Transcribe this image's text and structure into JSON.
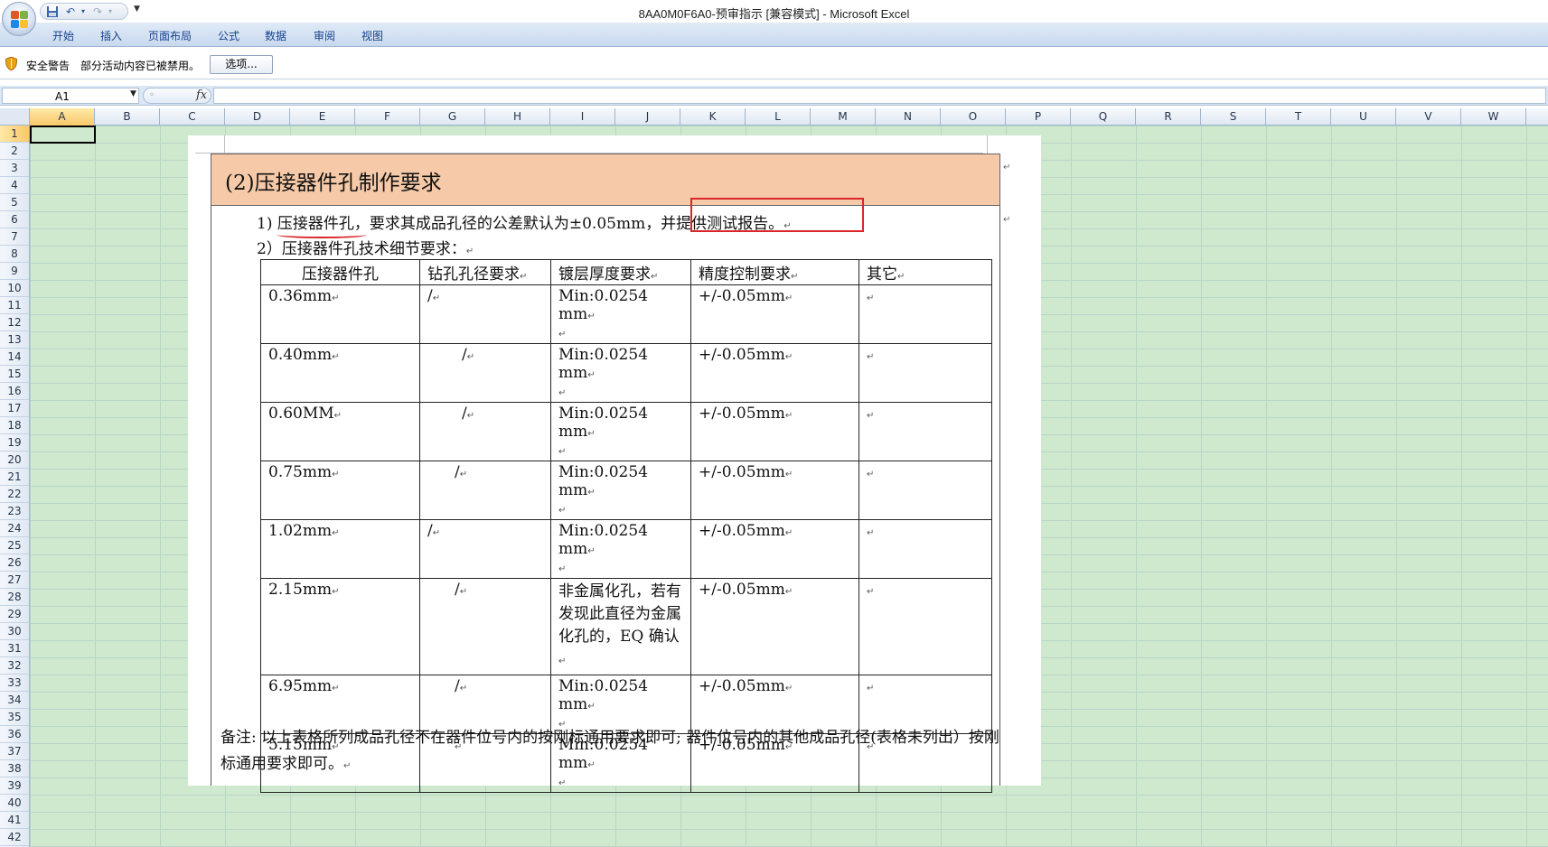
{
  "window": {
    "title": "8AA0M0F6A0-预审指示  [兼容模式] - Microsoft Excel",
    "qat_save": "save-icon",
    "qat_undo": "undo-icon",
    "qat_redo": "redo-icon",
    "qat_custom": "▼"
  },
  "ribbon": {
    "tabs": [
      "开始",
      "插入",
      "页面布局",
      "公式",
      "数据",
      "审阅",
      "视图"
    ]
  },
  "security_bar": {
    "title": "安全警告",
    "message": "部分活动内容已被禁用。",
    "options_label": "选项..."
  },
  "formula_bar": {
    "name_box": "A1",
    "fx_label": "fx",
    "formula": ""
  },
  "sheet": {
    "columns": [
      "A",
      "B",
      "C",
      "D",
      "E",
      "F",
      "G",
      "H",
      "I",
      "J",
      "K",
      "L",
      "M",
      "N",
      "O",
      "P",
      "Q",
      "R",
      "S",
      "T",
      "U",
      "V",
      "W"
    ],
    "rows": [
      "1",
      "2",
      "3",
      "4",
      "5",
      "6",
      "7",
      "8",
      "9",
      "10",
      "11",
      "12",
      "13",
      "14",
      "15",
      "16",
      "17",
      "18",
      "19",
      "20",
      "21",
      "22",
      "23",
      "24",
      "25",
      "26",
      "27",
      "28",
      "29",
      "30",
      "31",
      "32",
      "33",
      "34",
      "35",
      "36",
      "37",
      "38",
      "39",
      "40",
      "41",
      "42"
    ],
    "active_cell": "A1"
  },
  "doc": {
    "heading": "(2)压接器件孔制作要求",
    "line1_prefix": "1) 压接器件孔，要求其成品孔径的公差默认为±0.05mm",
    "line1_highlight": "，并提供测试报告。",
    "line2": "2）压接器件孔技术细节要求：",
    "para_mark": "↵",
    "table": {
      "headers": [
        "压接器件孔",
        "钻孔孔径要求",
        "镀层厚度要求",
        "精度控制要求",
        "其它"
      ],
      "rows": [
        [
          "0.36mm",
          "/",
          "Min:0.0254 mm",
          "+/-0.05mm",
          ""
        ],
        [
          "0.40mm",
          "/",
          "Min:0.0254 mm",
          "+/-0.05mm",
          ""
        ],
        [
          "0.60MM",
          "/",
          "Min:0.0254 mm",
          "+/-0.05mm",
          ""
        ],
        [
          "0.75mm",
          "/",
          "Min:0.0254 mm",
          "+/-0.05mm",
          ""
        ],
        [
          "1.02mm",
          "/",
          "Min:0.0254 mm",
          "+/-0.05mm",
          ""
        ],
        [
          "2.15mm",
          "/",
          "非金属化孔，若有发现此直径为金属化孔的，EQ 确认",
          "+/-0.05mm",
          ""
        ],
        [
          "6.95mm",
          "/",
          "Min:0.0254 mm",
          "+/-0.05mm",
          ""
        ],
        [
          "5.15mm",
          "",
          "Min:0.0254 mm",
          "+/-0.05mm",
          ""
        ]
      ]
    },
    "note": "备注: 以上表格所列成品孔径不在器件位号内的按刚标通用要求即可; 器件位号内的其他成品孔径(表格未列出）按刚标通用要求即可。"
  },
  "colors": {
    "grid_bg": "#cfe9cf",
    "heading_bg": "#f6caa8",
    "highlight": "#d8262b",
    "ribbon_text": "#15428b"
  }
}
